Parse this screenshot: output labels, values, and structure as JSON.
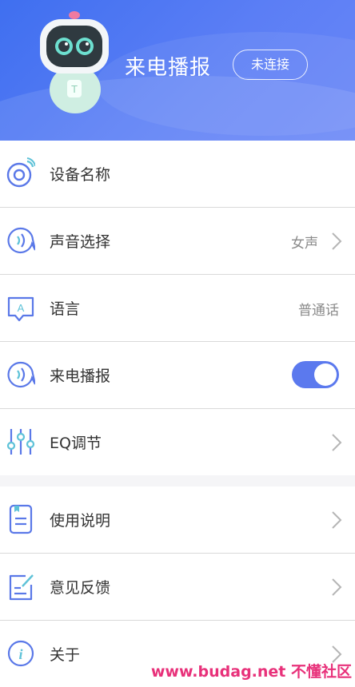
{
  "header": {
    "title": "来电播报",
    "connection_button": "未连接"
  },
  "settings": {
    "device_name": {
      "label": "设备名称"
    },
    "voice_select": {
      "label": "声音选择",
      "value": "女声"
    },
    "language": {
      "label": "语言",
      "value": "普通话"
    },
    "call_announce": {
      "label": "来电播报",
      "enabled": true
    },
    "eq": {
      "label": "EQ调节"
    }
  },
  "info": {
    "manual": {
      "label": "使用说明"
    },
    "feedback": {
      "label": "意见反馈"
    },
    "about": {
      "label": "关于"
    }
  },
  "watermark": {
    "text": "www.budag.net 不懂社区"
  },
  "colors": {
    "accent": "#5b79ee",
    "header": "#4d76f2",
    "watermark": "#e8317a"
  }
}
